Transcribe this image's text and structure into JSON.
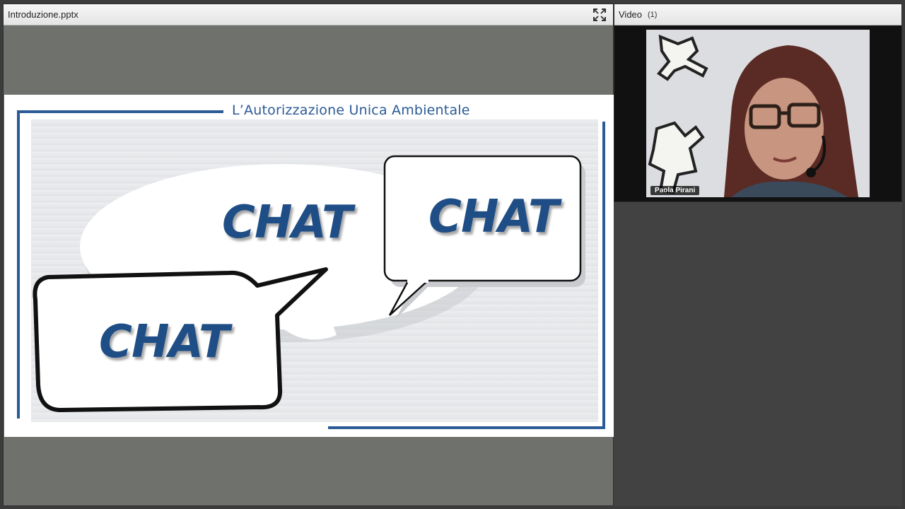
{
  "share_pod": {
    "title": "Introduzione.pptx"
  },
  "video_pod": {
    "title": "Video",
    "count": "(1)",
    "participant_name": "Paola Pirani"
  },
  "slide": {
    "title": "L’Autorizzazione Unica Ambientale",
    "bubble_center": "CHAT",
    "bubble_right": "CHAT",
    "bubble_left": "CHAT"
  },
  "colors": {
    "accent_blue": "#2b5a96",
    "chat_text": "#1f4e86"
  },
  "icons": {
    "fullscreen": "fullscreen-icon"
  }
}
